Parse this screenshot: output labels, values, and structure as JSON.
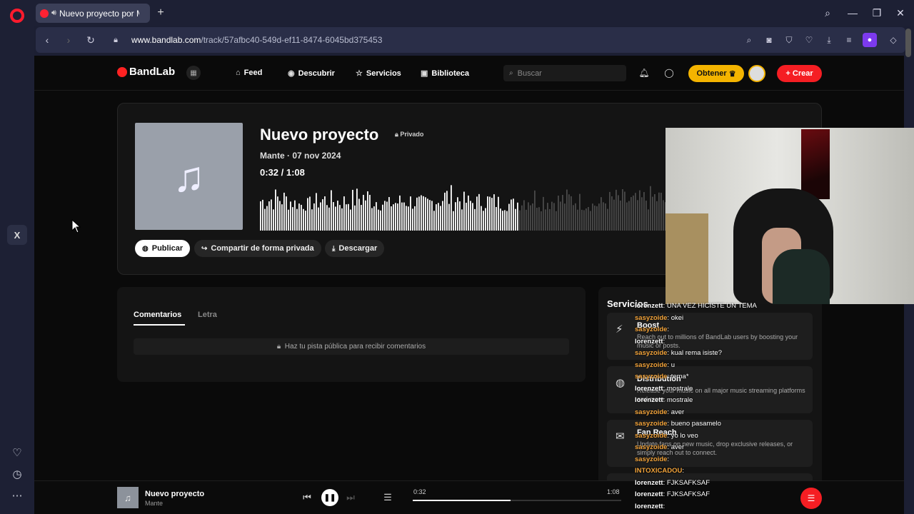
{
  "browser": {
    "tab_title": "Nuevo proyecto por Mante",
    "url_host": "www.bandlab.com",
    "url_path": "/track/57afbc40-549d-ef11-8474-6045bd375453"
  },
  "site": {
    "logo_text": "BandLab",
    "nav": [
      {
        "label": "Feed",
        "icon": "home-icon"
      },
      {
        "label": "Descubrir",
        "icon": "compass-icon"
      },
      {
        "label": "Servicios",
        "icon": "star-icon"
      },
      {
        "label": "Biblioteca",
        "icon": "library-icon"
      }
    ],
    "search_placeholder": "Buscar",
    "obtener_label": "Obtener",
    "crear_label": "Crear"
  },
  "track": {
    "title": "Nuevo proyecto",
    "privacy": "Privado",
    "artist_date": "Mante · 07 nov 2024",
    "time_display": "0:32 /  1:08",
    "progress": 0.47,
    "publish_label": "Publicar",
    "share_label": "Compartir de forma privada",
    "download_label": "Descargar"
  },
  "comments": {
    "tab_comments": "Comentarios",
    "tab_lyrics": "Letra",
    "notice": "Haz tu pista pública para recibir comentarios"
  },
  "services": {
    "title": "Servicios",
    "items": [
      {
        "name": "Boost",
        "desc": "Reach out to millions of BandLab users by boosting your music or posts.",
        "icon": "bolt-icon"
      },
      {
        "name": "Distribution",
        "desc": "Release your music on all major music streaming platforms and more.",
        "icon": "globe-icon"
      },
      {
        "name": "Fan Reach",
        "desc": "Update fans on new music, drop exclusive releases, or simply reach out to connect.",
        "icon": "mail-icon"
      }
    ]
  },
  "chat": [
    {
      "user": "lorenzett",
      "msg": "UNA VEZ HICISTE UN TEMA",
      "color": "#ffffff"
    },
    {
      "user": "sasyzoide",
      "msg": "okei",
      "color": "#f2a33a"
    },
    {
      "user": "sasyzoide",
      "msg": "",
      "color": "#f2a33a"
    },
    {
      "user": "lorenzett",
      "msg": "",
      "color": "#ffffff"
    },
    {
      "user": "sasyzoide",
      "msg": "kual rema isiste?",
      "color": "#f2a33a"
    },
    {
      "user": "sasyzoide",
      "msg": "u",
      "color": "#f2a33a"
    },
    {
      "user": "sasyzoide",
      "msg": "tema*",
      "color": "#f2a33a"
    },
    {
      "user": "lorenzett",
      "msg": "mostrale",
      "color": "#ffffff"
    },
    {
      "user": "lorenzett",
      "msg": "mostrale",
      "color": "#ffffff"
    },
    {
      "user": "sasyzoide",
      "msg": "aver",
      "color": "#f2a33a"
    },
    {
      "user": "sasyzoide",
      "msg": "bueno pasamelo",
      "color": "#f2a33a"
    },
    {
      "user": "sasyzoide",
      "msg": "yo lo veo",
      "color": "#f2a33a"
    },
    {
      "user": "sasyzoide",
      "msg": "aver",
      "color": "#f2a33a"
    },
    {
      "user": "sasyzoide",
      "msg": "",
      "color": "#f2a33a"
    },
    {
      "user": "INTOXICADOU",
      "msg": "",
      "color": "#f2a33a"
    },
    {
      "user": "lorenzett",
      "msg": "FJKSAFKSAF",
      "color": "#ffffff"
    },
    {
      "user": "lorenzett",
      "msg": "FJKSAFKSAF",
      "color": "#ffffff"
    },
    {
      "user": "lorenzett",
      "msg": "",
      "color": "#ffffff"
    }
  ],
  "player": {
    "title": "Nuevo proyecto",
    "artist": "Mante",
    "current": "0:32",
    "duration": "1:08",
    "progress": 0.47
  },
  "colors": {
    "accent": "#f51e23",
    "gold": "#f4b400"
  }
}
